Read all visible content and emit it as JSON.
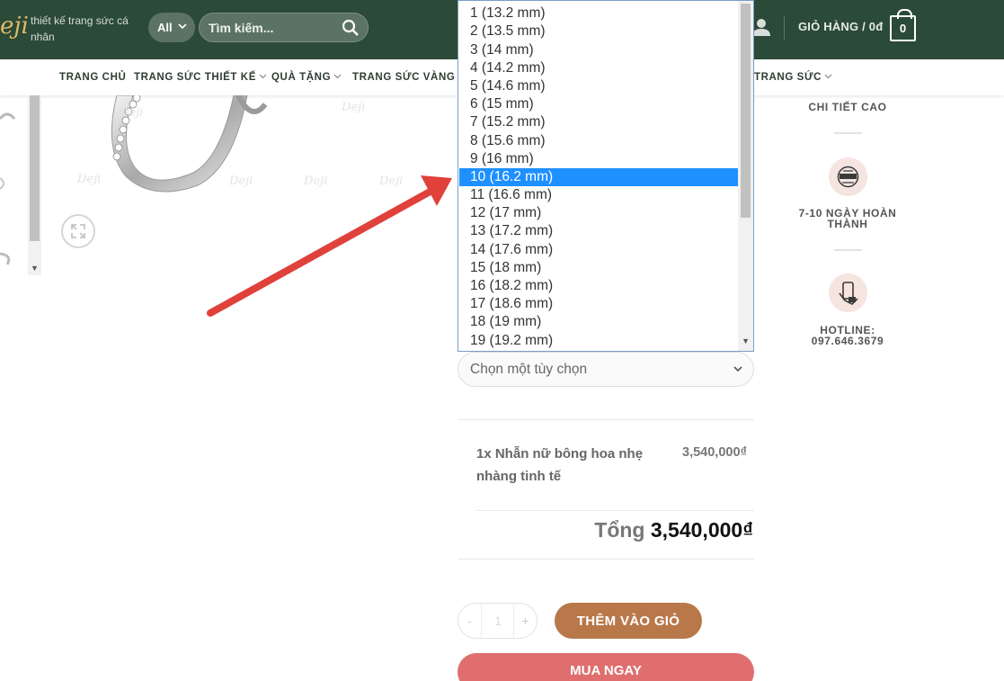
{
  "header": {
    "logo_text": "eji",
    "tagline": "thiết kế trang sức cá nhân",
    "category": "All",
    "search_placeholder": "Tìm kiếm...",
    "cart_label": "GIỎ HÀNG / 0đ",
    "cart_count": "0"
  },
  "nav": {
    "items": [
      "TRANG CHỦ",
      "TRANG SỨC THIẾT KẾ",
      "QUÀ TẶNG",
      "TRANG SỨC VÀNG",
      "TRANG SỨC"
    ]
  },
  "gallery": {
    "watermark": "Deji"
  },
  "size_dropdown": {
    "options": [
      "1 (13.2 mm)",
      "2 (13.5 mm)",
      "3 (14 mm)",
      "4 (14.2 mm)",
      "5 (14.6 mm)",
      "6 (15 mm)",
      "7 (15.2 mm)",
      "8 (15.6 mm)",
      "9 (16 mm)",
      "10 (16.2 mm)",
      "11 (16.6 mm)",
      "12 (17 mm)",
      "13 (17.2 mm)",
      "14 (17.6 mm)",
      "15 (18 mm)",
      "16 (18.2 mm)",
      "17 (18.6 mm)",
      "18 (19 mm)",
      "19 (19.2 mm)"
    ],
    "selected": "10 (16.2 mm)"
  },
  "option_select": {
    "placeholder": "Chọn một tùy chọn"
  },
  "order": {
    "item_name": "1x Nhẫn nữ bông hoa nhẹ nhàng tinh tế",
    "item_price": "3,540,000₫",
    "total_label": "Tổng",
    "total_value": "3,540,000₫",
    "quantity": "1",
    "minus": "-",
    "plus": "+",
    "add_to_cart": "THÊM VÀO GIỎ",
    "buy_now": "MUA NGAY"
  },
  "features": {
    "item1": "CHI TIẾT CAO",
    "item2": "7-10 NGÀY HOÀN THÀNH",
    "item3": "HOTLINE: 097.646.3679"
  },
  "colors": {
    "header_bg": "#2b4a37",
    "accent_gold": "#e0b96a",
    "add_button": "#b8784a",
    "buy_button": "#e06e6e",
    "selected_option": "#1e90ff",
    "arrow": "#e0413b"
  },
  "icons": {
    "search": "search-icon",
    "user": "user-icon",
    "cart": "cart-icon",
    "zoom": "expand-icon",
    "handmade": "handmade-badge-icon",
    "hotline": "phone-hand-icon"
  }
}
